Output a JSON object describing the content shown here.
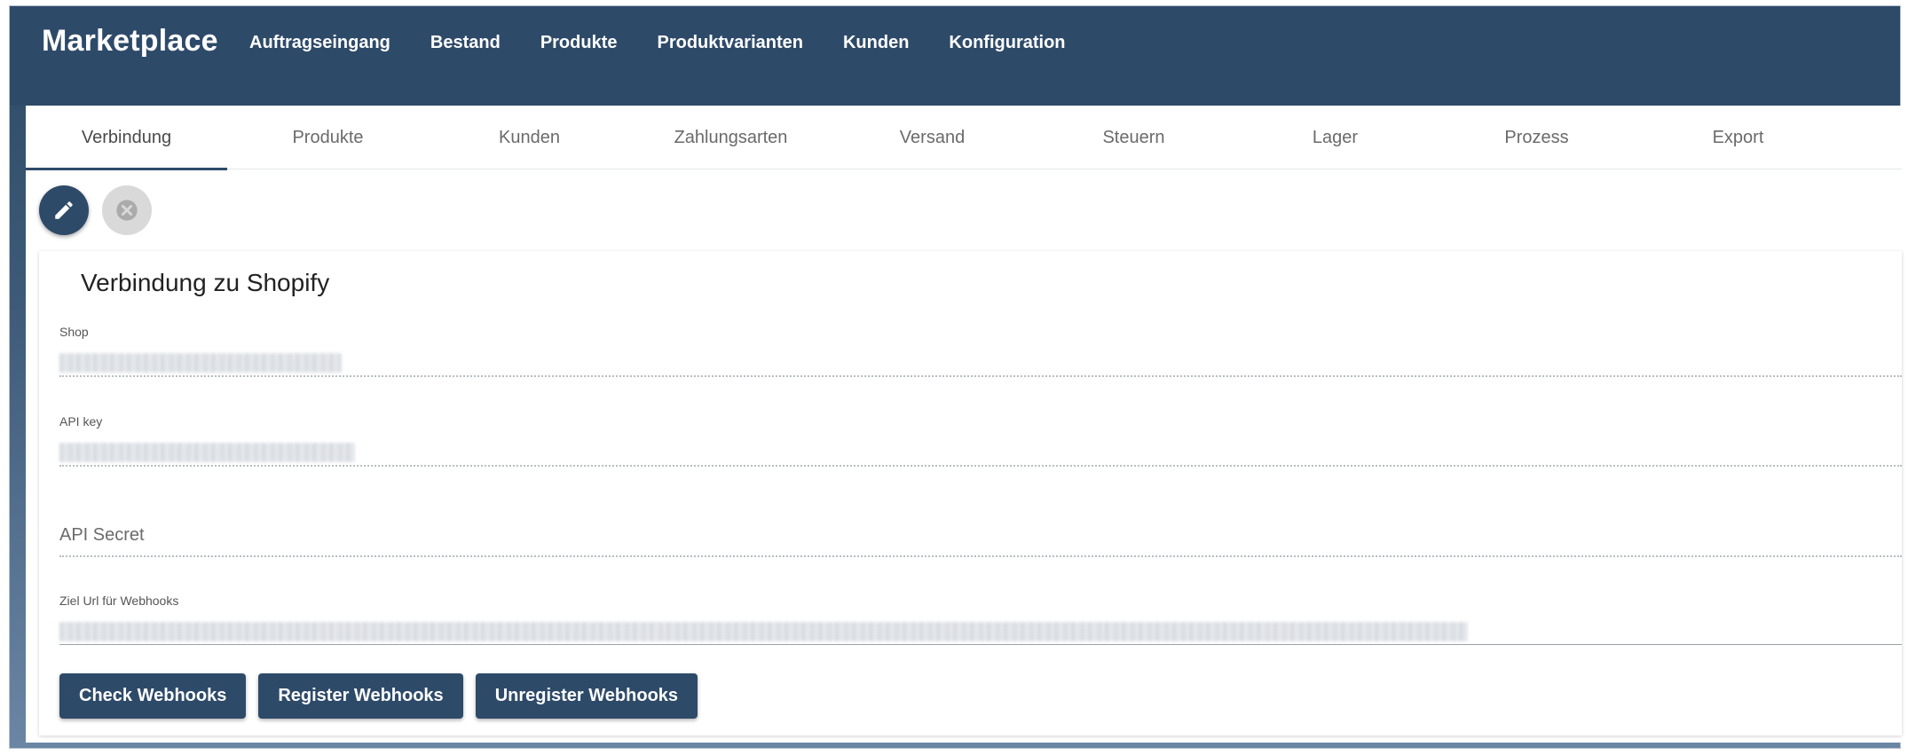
{
  "app": {
    "brand": "Marketplace",
    "nav": [
      "Auftragseingang",
      "Bestand",
      "Produkte",
      "Produktvarianten",
      "Kunden",
      "Konfiguration"
    ]
  },
  "tabs": [
    "Verbindung",
    "Produkte",
    "Kunden",
    "Zahlungsarten",
    "Versand",
    "Steuern",
    "Lager",
    "Prozess",
    "Export"
  ],
  "active_tab": "Verbindung",
  "toolbar": {
    "edit_icon": "pencil-icon",
    "cancel_icon": "close-circle-icon"
  },
  "card": {
    "title": "Verbindung zu Shopify",
    "fields": {
      "shop_label": "Shop",
      "api_key_label": "API key",
      "api_secret_placeholder": "API Secret",
      "webhook_label": "Ziel Url für Webhooks"
    },
    "buttons": {
      "check": "Check Webhooks",
      "register": "Register Webhooks",
      "unregister": "Unregister Webhooks"
    }
  },
  "colors": {
    "primary": "#2e4a69",
    "fab_inactive": "#d9d9d9"
  }
}
